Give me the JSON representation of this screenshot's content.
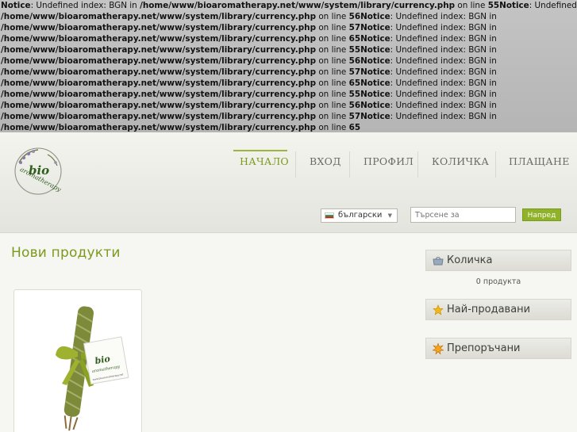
{
  "notices": [
    [
      {
        "t": "Notice",
        "b": true
      },
      {
        "t": ": Undefined index: BGN in ",
        "b": false
      },
      {
        "t": "/home/www/bioaromatherapy.net/www/system/library/currency.php",
        "b": true
      },
      {
        "t": " on line ",
        "b": false
      },
      {
        "t": "55Notice",
        "b": true
      },
      {
        "t": ": Undefined index: BGN in",
        "b": false
      }
    ],
    [
      {
        "t": "/home/www/bioaromatherapy.net/www/system/library/currency.php",
        "b": true
      },
      {
        "t": " on line ",
        "b": false
      },
      {
        "t": "56Notice",
        "b": true
      },
      {
        "t": ": Undefined index: BGN in",
        "b": false
      }
    ],
    [
      {
        "t": "/home/www/bioaromatherapy.net/www/system/library/currency.php",
        "b": true
      },
      {
        "t": " on line ",
        "b": false
      },
      {
        "t": "57Notice",
        "b": true
      },
      {
        "t": ": Undefined index: BGN in",
        "b": false
      }
    ],
    [
      {
        "t": "/home/www/bioaromatherapy.net/www/system/library/currency.php",
        "b": true
      },
      {
        "t": " on line ",
        "b": false
      },
      {
        "t": "65Notice",
        "b": true
      },
      {
        "t": ": Undefined index: BGN in",
        "b": false
      }
    ],
    [
      {
        "t": "/home/www/bioaromatherapy.net/www/system/library/currency.php",
        "b": true
      },
      {
        "t": " on line ",
        "b": false
      },
      {
        "t": "55Notice",
        "b": true
      },
      {
        "t": ": Undefined index: BGN in",
        "b": false
      }
    ],
    [
      {
        "t": "/home/www/bioaromatherapy.net/www/system/library/currency.php",
        "b": true
      },
      {
        "t": " on line ",
        "b": false
      },
      {
        "t": "56Notice",
        "b": true
      },
      {
        "t": ": Undefined index: BGN in",
        "b": false
      }
    ],
    [
      {
        "t": "/home/www/bioaromatherapy.net/www/system/library/currency.php",
        "b": true
      },
      {
        "t": " on line ",
        "b": false
      },
      {
        "t": "57Notice",
        "b": true
      },
      {
        "t": ": Undefined index: BGN in",
        "b": false
      }
    ],
    [
      {
        "t": "/home/www/bioaromatherapy.net/www/system/library/currency.php",
        "b": true
      },
      {
        "t": " on line ",
        "b": false
      },
      {
        "t": "65Notice",
        "b": true
      },
      {
        "t": ": Undefined index: BGN in",
        "b": false
      }
    ],
    [
      {
        "t": "/home/www/bioaromatherapy.net/www/system/library/currency.php",
        "b": true
      },
      {
        "t": " on line ",
        "b": false
      },
      {
        "t": "55Notice",
        "b": true
      },
      {
        "t": ": Undefined index: BGN in",
        "b": false
      }
    ],
    [
      {
        "t": "/home/www/bioaromatherapy.net/www/system/library/currency.php",
        "b": true
      },
      {
        "t": " on line ",
        "b": false
      },
      {
        "t": "56Notice",
        "b": true
      },
      {
        "t": ": Undefined index: BGN in",
        "b": false
      }
    ],
    [
      {
        "t": "/home/www/bioaromatherapy.net/www/system/library/currency.php",
        "b": true
      },
      {
        "t": " on line ",
        "b": false
      },
      {
        "t": "57Notice",
        "b": true
      },
      {
        "t": ": Undefined index: BGN in",
        "b": false
      }
    ],
    [
      {
        "t": "/home/www/bioaromatherapy.net/www/system/library/currency.php",
        "b": true
      },
      {
        "t": " on line ",
        "b": false
      },
      {
        "t": "65",
        "b": true
      }
    ]
  ],
  "logo": {
    "brand": "bio",
    "tagline": "aromatherapy"
  },
  "nav": [
    {
      "label": "НАЧАЛО",
      "active": true
    },
    {
      "label": "ВХОД",
      "active": false
    },
    {
      "label": "ПРОФИЛ",
      "active": false
    },
    {
      "label": "КОЛИЧКА",
      "active": false
    },
    {
      "label": "ПЛАЩАНЕ",
      "active": false
    }
  ],
  "language": {
    "selected": "български"
  },
  "search": {
    "placeholder": "Търсене за",
    "button": "Напред"
  },
  "main": {
    "title": "Нови продукти"
  },
  "product": {
    "tag_brand": "bio",
    "tag_tagline": "aromatherapy",
    "tag_url": "www.bioaromatherapy.net"
  },
  "sidebar": {
    "cart": {
      "title": "Количка",
      "count_text": "0 продукта"
    },
    "bestsellers": {
      "title": "Най-продавани"
    },
    "featured": {
      "title": "Препоръчани"
    }
  },
  "colors": {
    "accent": "#7a9a1e",
    "button": "#8fb229"
  },
  "icons": {
    "cart": "cart-icon",
    "bestsellers": "star-icon",
    "featured": "burst-icon",
    "lang": "flag-bg-icon"
  }
}
